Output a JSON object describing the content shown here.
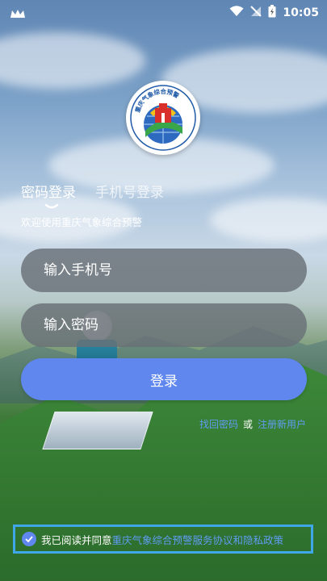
{
  "status_bar": {
    "time": "10:05",
    "icons": [
      "crown-icon",
      "wifi-icon",
      "no-signal-icon",
      "battery-charging-icon"
    ]
  },
  "logo": {
    "text": "重庆气象综合预警",
    "colors": {
      "blue": "#1f5aa8",
      "red": "#d9302b",
      "green": "#3aa64a",
      "yellow": "#f2c21a"
    }
  },
  "tabs": {
    "password_login": "密码登录",
    "phone_login": "手机号登录"
  },
  "welcome": "欢迎使用重庆气象综合预警",
  "form": {
    "phone_placeholder": "输入手机号",
    "password_placeholder": "输入密码",
    "login_button": "登录"
  },
  "links": {
    "forgot_password": "找回密码",
    "or": "或",
    "register": "注册新用户"
  },
  "agreement": {
    "prefix": "我已阅读并同意",
    "policy": "重庆气象综合预警服务协议和隐私政策",
    "checked": true
  },
  "colors": {
    "accent": "#5f87ee",
    "link": "#5f9cf2",
    "highlight_border": "#3fa6e8"
  }
}
